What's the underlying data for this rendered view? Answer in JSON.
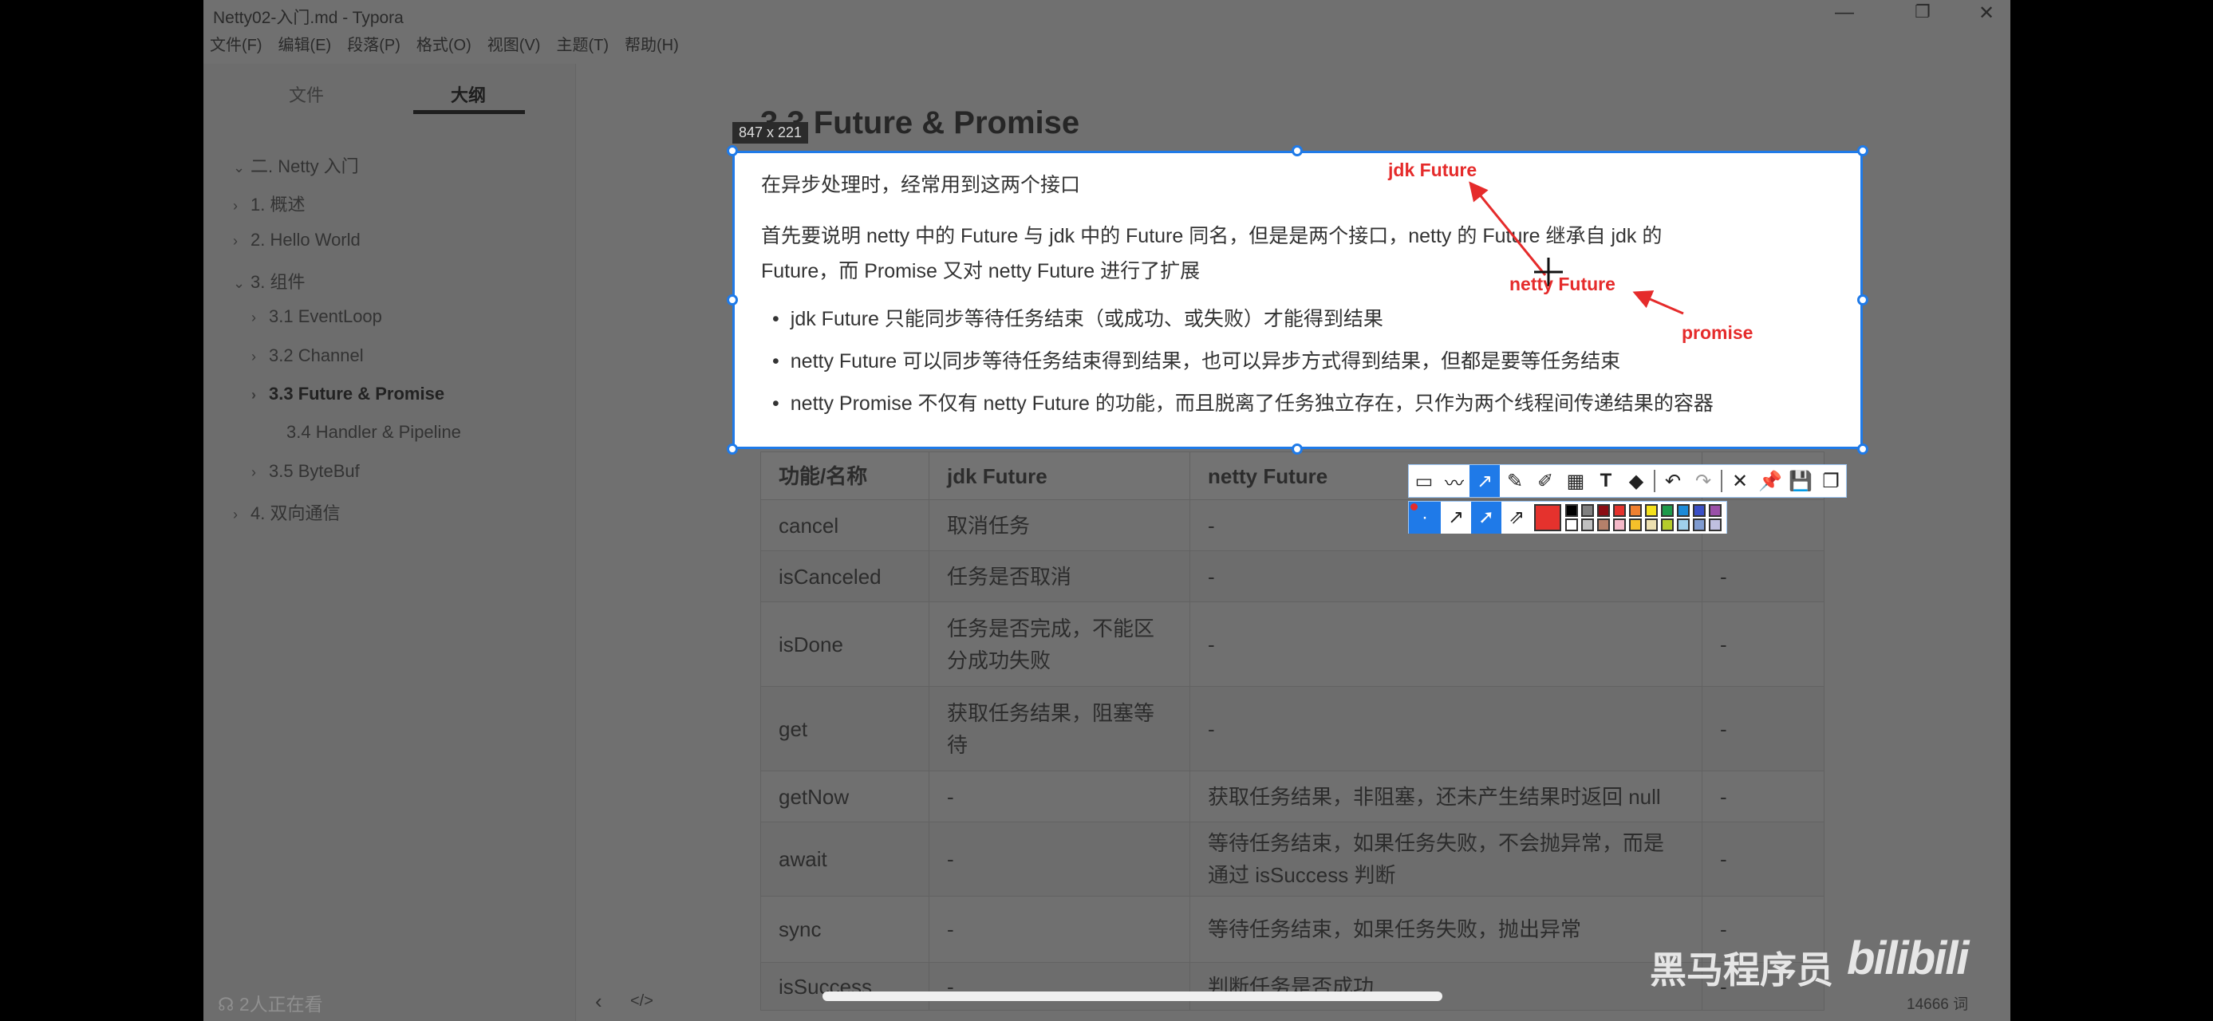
{
  "window": {
    "title": "Netty02-入门.md - Typora",
    "minimize": "—",
    "maximize": "❐",
    "close": "✕"
  },
  "menu": [
    "文件(F)",
    "编辑(E)",
    "段落(P)",
    "格式(O)",
    "视图(V)",
    "主题(T)",
    "帮助(H)"
  ],
  "sidebar": {
    "tabs": [
      "文件",
      "大纲"
    ],
    "outline": [
      {
        "label": "二. Netty 入门",
        "chev": "⌄"
      },
      {
        "label": "1. 概述",
        "chev": "›"
      },
      {
        "label": "2. Hello World",
        "chev": "›"
      },
      {
        "label": "3. 组件",
        "chev": "⌄"
      },
      {
        "label": "3.1 EventLoop",
        "chev": "›"
      },
      {
        "label": "3.2 Channel",
        "chev": "›"
      },
      {
        "label": "3.3 Future & Promise",
        "chev": "›"
      },
      {
        "label": "3.4 Handler & Pipeline",
        "chev": ""
      },
      {
        "label": "3.5 ByteBuf",
        "chev": "›"
      },
      {
        "label": "4. 双向通信",
        "chev": "›"
      }
    ],
    "viewers": "2人正在看"
  },
  "main": {
    "heading": "3.3 Future & Promise",
    "selection_size": "847 x 221",
    "para1": "在异步处理时，经常用到这两个接口",
    "para2a": "首先要说明 netty 中的 Future 与 jdk 中的 Future 同名，但是是两个接口，netty 的 Future 继承自 jdk 的",
    "para2b": "Future，而 Promise 又对 netty Future 进行了扩展",
    "bullets": [
      "jdk Future 只能同步等待任务结束（或成功、或失败）才能得到结果",
      "netty Future 可以同步等待任务结束得到结果，也可以异步方式得到结果，但都是要等任务结束",
      "netty Promise 不仅有 netty Future 的功能，而且脱离了任务独立存在，只作为两个线程间传递结果的容器"
    ],
    "annotations": {
      "jdk": "jdk Future",
      "netty": "netty Future",
      "promise": "promise"
    },
    "table": {
      "headers": [
        "功能/名称",
        "jdk Future",
        "netty Future",
        ""
      ],
      "rows": [
        [
          "cancel",
          "取消任务",
          "-",
          ""
        ],
        [
          "isCanceled",
          "任务是否取消",
          "-",
          "-"
        ],
        [
          "isDone",
          "任务是否完成，不能区分成功失败",
          "-",
          "-"
        ],
        [
          "get",
          "获取任务结果，阻塞等待",
          "-",
          "-"
        ],
        [
          "getNow",
          "-",
          "获取任务结果，非阻塞，还未产生结果时返回 null",
          "-"
        ],
        [
          "await",
          "-",
          "等待任务结束，如果任务失败，不会抛异常，而是通过 isSuccess 判断",
          "-"
        ],
        [
          "sync",
          "-",
          "等待任务结束，如果任务失败，抛出异常",
          "-"
        ],
        [
          "isSuccess",
          "-",
          "判断任务是否成功",
          "-"
        ]
      ]
    }
  },
  "status": {
    "back": "‹",
    "source": "</>",
    "words": "14666 词"
  },
  "watermark": {
    "text": "黑马程序员",
    "logo": "bilibili"
  },
  "palette": [
    "#000000",
    "#808080",
    "#8b0d14",
    "#e5322d",
    "#f08030",
    "#f5e11c",
    "#1e9a4a",
    "#1b8ad8",
    "#3a4fc6",
    "#9a4fa8",
    "#ffffff",
    "#c0c0c0",
    "#b5806a",
    "#f5b8c8",
    "#f5c02a",
    "#ede0b0",
    "#b5cc2a",
    "#9fd0ea",
    "#7f9bd0",
    "#c0c0e0"
  ]
}
